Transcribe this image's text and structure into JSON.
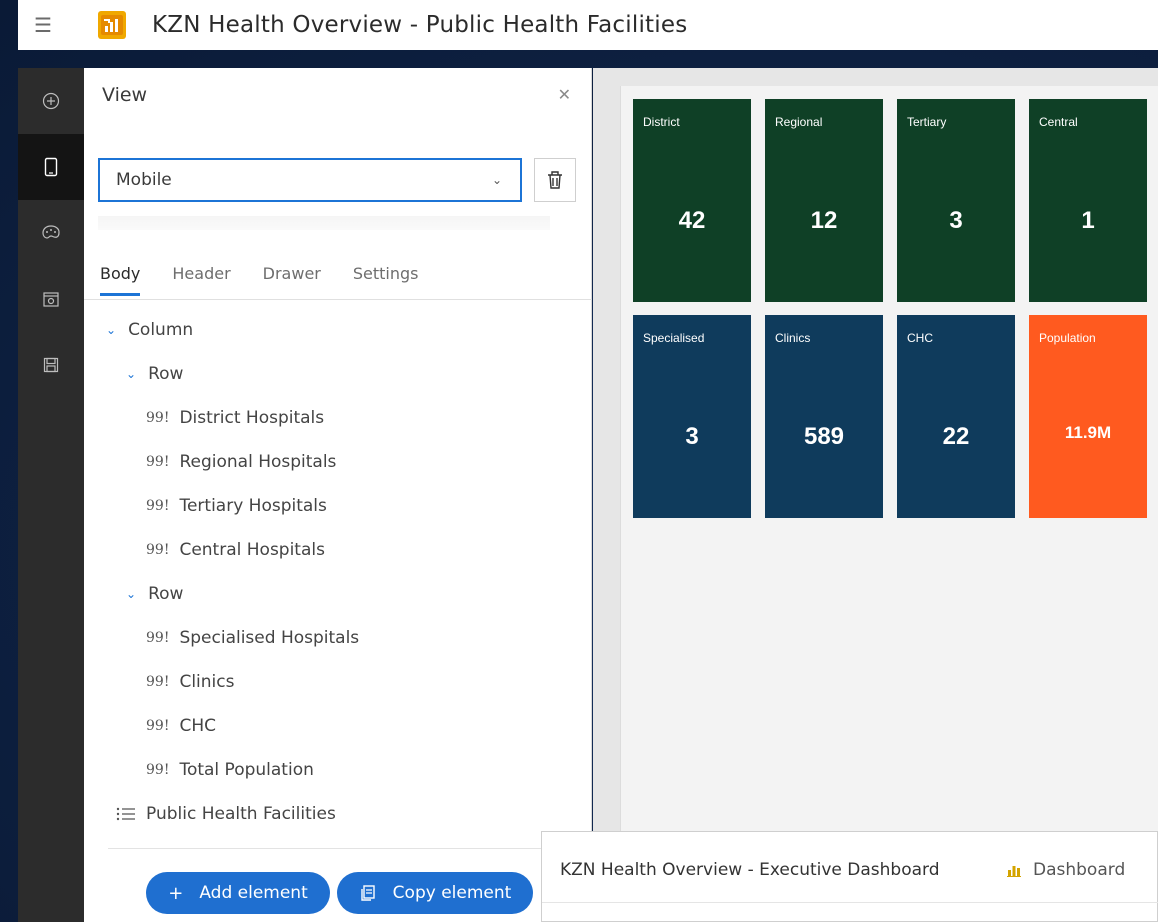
{
  "app": {
    "title": "KZN Health Overview - Public Health Facilities"
  },
  "panel": {
    "title": "View",
    "view_select": "Mobile",
    "tabs": [
      "Body",
      "Header",
      "Drawer",
      "Settings"
    ],
    "tree": {
      "column": "Column",
      "row1": "Row",
      "row1_items": [
        "District Hospitals",
        "Regional Hospitals",
        "Tertiary Hospitals",
        "Central Hospitals"
      ],
      "row2": "Row",
      "row2_items": [
        "Specialised Hospitals",
        "Clinics",
        "CHC",
        "Total Population"
      ],
      "list": "Public Health Facilities"
    },
    "indicator_glyph": "99!",
    "add_label": "Add element",
    "copy_label": "Copy element"
  },
  "tiles": [
    {
      "label": "District",
      "value": "42",
      "color": "#0f4026"
    },
    {
      "label": "Regional",
      "value": "12",
      "color": "#0f4026"
    },
    {
      "label": "Tertiary",
      "value": "3",
      "color": "#0f4026"
    },
    {
      "label": "Central",
      "value": "1",
      "color": "#0f4026"
    },
    {
      "label": "Specialised",
      "value": "3",
      "color": "#0f3b5c"
    },
    {
      "label": "Clinics",
      "value": "589",
      "color": "#0f3b5c"
    },
    {
      "label": "CHC",
      "value": "22",
      "color": "#0f3b5c"
    },
    {
      "label": "Population",
      "value": "11.9M",
      "color": "#ff5a1f"
    }
  ],
  "floating": {
    "title": "KZN Health Overview - Executive Dashboard",
    "type_label": "Dashboard"
  }
}
